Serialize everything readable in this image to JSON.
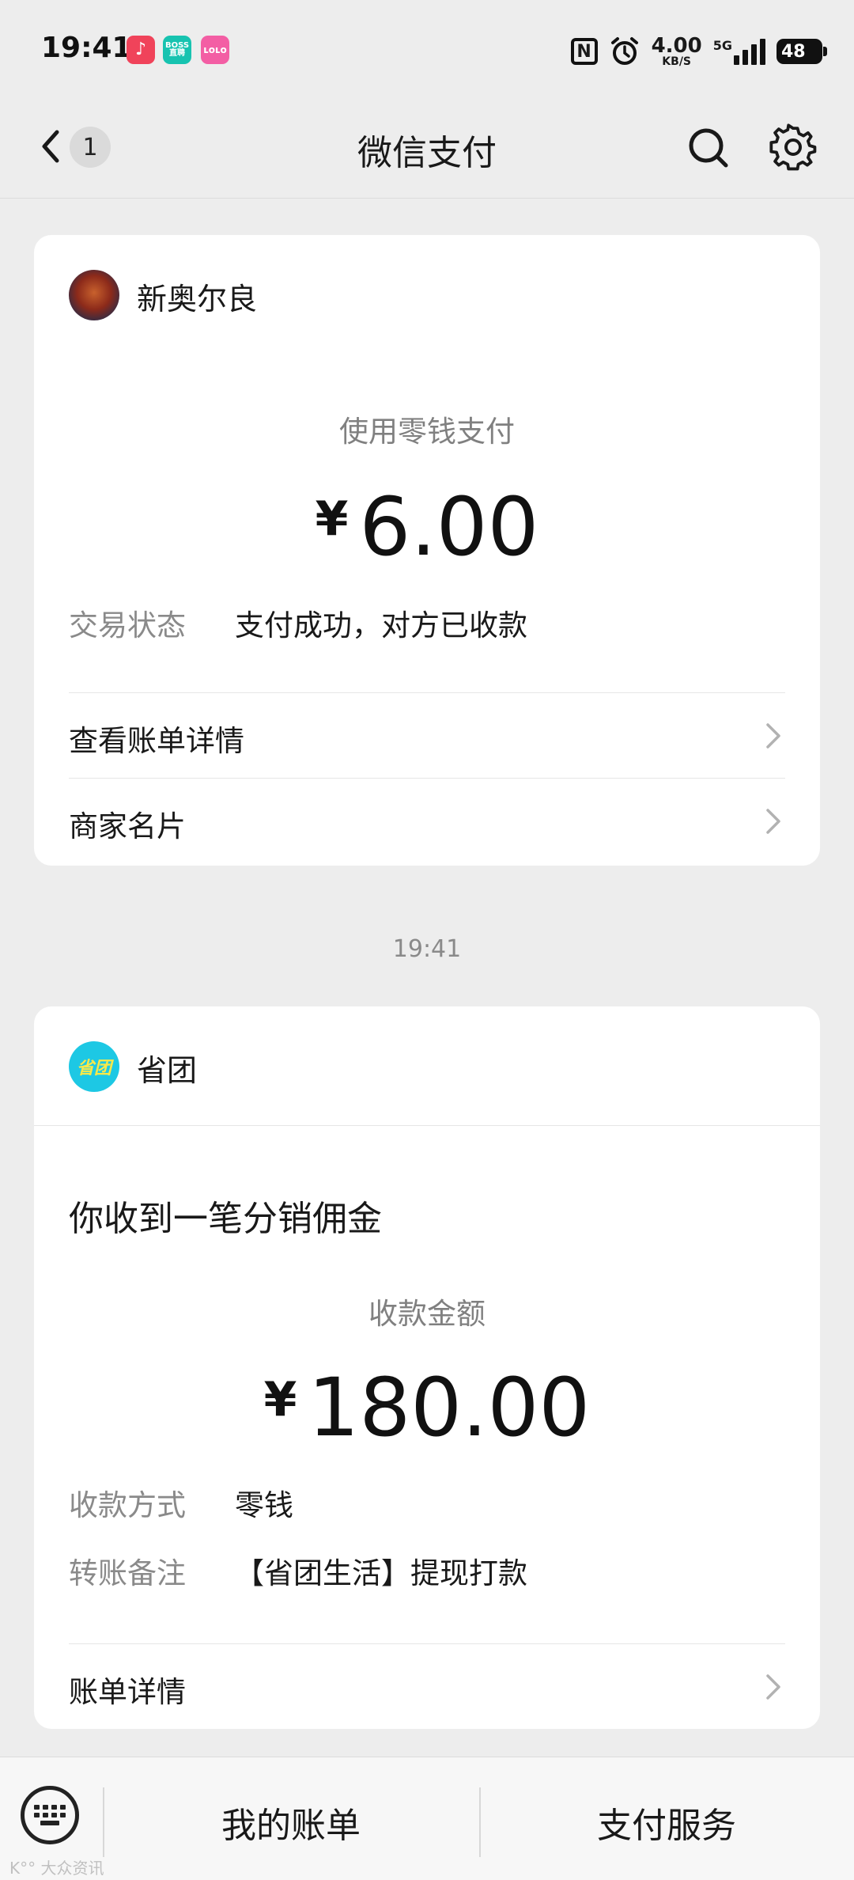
{
  "status_bar": {
    "time": "19:41",
    "app_icons": [
      {
        "name": "music-app-icon",
        "text": "♪",
        "color": "#f0435a"
      },
      {
        "name": "boss-app-icon",
        "text": "BOSS\n直聘",
        "color": "#17c3b0"
      },
      {
        "name": "pink-app-icon",
        "text": "ʟoʟo",
        "color": "#f35ea4"
      }
    ],
    "nfc": "N",
    "speed_value": "4.00",
    "speed_unit": "KB/S",
    "network": "5G",
    "battery": "48"
  },
  "nav": {
    "back_badge": "1",
    "title": "微信支付"
  },
  "card1": {
    "merchant": "新奥尔良",
    "pay_method": "使用零钱支付",
    "currency": "¥",
    "amount": "6.00",
    "status_key": "交易状态",
    "status_value": "支付成功，对方已收款",
    "rows": [
      {
        "label": "查看账单详情"
      },
      {
        "label": "商家名片"
      }
    ]
  },
  "time_separator": "19:41",
  "card2": {
    "merchant": "省团",
    "avatar_text": "省团",
    "headline": "你收到一笔分销佣金",
    "amount_label": "收款金额",
    "currency": "¥",
    "amount": "180.00",
    "method_key": "收款方式",
    "method_value": "零钱",
    "note_key": "转账备注",
    "note_value": "【省团生活】提现打款",
    "row_label": "账单详情"
  },
  "bottom_bar": {
    "tab1": "我的账单",
    "tab2": "支付服务"
  },
  "watermark": "K°° 大众资讯"
}
